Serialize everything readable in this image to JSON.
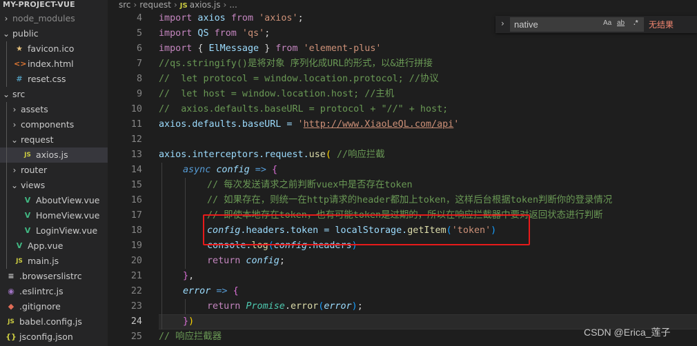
{
  "explorer": {
    "title": "MY-PROJECT-VUE",
    "items": [
      {
        "label": "node_modules",
        "type": "folder",
        "chev": "›",
        "icon": "",
        "color": "#8b8b8b"
      },
      {
        "label": "public",
        "type": "folder",
        "chev": "⌄",
        "icon": "",
        "color": "#cccccc"
      },
      {
        "label": "favicon.ico",
        "type": "file",
        "chev": "",
        "icon": "★",
        "color": "#cccccc"
      },
      {
        "label": "index.html",
        "type": "file",
        "chev": "",
        "icon": "<>",
        "color": "#cccccc"
      },
      {
        "label": "reset.css",
        "type": "file",
        "chev": "",
        "icon": "#",
        "color": "#cccccc"
      },
      {
        "label": "src",
        "type": "folder",
        "chev": "⌄",
        "icon": "",
        "color": "#cccccc"
      },
      {
        "label": "assets",
        "type": "folder",
        "chev": "›",
        "icon": "",
        "color": "#cccccc"
      },
      {
        "label": "components",
        "type": "folder",
        "chev": "›",
        "icon": "",
        "color": "#cccccc"
      },
      {
        "label": "request",
        "type": "folder",
        "chev": "⌄",
        "icon": "",
        "color": "#cccccc"
      },
      {
        "label": "axios.js",
        "type": "file",
        "chev": "",
        "icon": "JS",
        "color": "#cccccc"
      },
      {
        "label": "router",
        "type": "folder",
        "chev": "›",
        "icon": "",
        "color": "#cccccc"
      },
      {
        "label": "views",
        "type": "folder",
        "chev": "⌄",
        "icon": "",
        "color": "#cccccc"
      },
      {
        "label": "AboutView.vue",
        "type": "file",
        "chev": "",
        "icon": "V",
        "color": "#cccccc"
      },
      {
        "label": "HomeView.vue",
        "type": "file",
        "chev": "",
        "icon": "V",
        "color": "#cccccc"
      },
      {
        "label": "LoginView.vue",
        "type": "file",
        "chev": "",
        "icon": "V",
        "color": "#cccccc"
      },
      {
        "label": "App.vue",
        "type": "file",
        "chev": "",
        "icon": "V",
        "color": "#cccccc"
      },
      {
        "label": "main.js",
        "type": "file",
        "chev": "",
        "icon": "JS",
        "color": "#cccccc"
      },
      {
        "label": ".browserslistrc",
        "type": "file",
        "chev": "",
        "icon": "≡",
        "color": "#cccccc"
      },
      {
        "label": ".eslintrc.js",
        "type": "file",
        "chev": "",
        "icon": "◉",
        "color": "#cccccc"
      },
      {
        "label": ".gitignore",
        "type": "file",
        "chev": "",
        "icon": "◆",
        "color": "#cccccc"
      },
      {
        "label": "babel.config.js",
        "type": "file",
        "chev": "",
        "icon": "JS",
        "color": "#cccccc"
      },
      {
        "label": "jsconfig.json",
        "type": "file",
        "chev": "",
        "icon": "{}",
        "color": "#cccccc"
      }
    ]
  },
  "breadcrumb": {
    "seg1": "src",
    "seg2": "request",
    "file_icon": "JS",
    "seg3": "axios.js",
    "seg4": "..."
  },
  "editor": {
    "line_numbers": [
      "4",
      "5",
      "6",
      "7",
      "8",
      "9",
      "10",
      "11",
      "12",
      "13",
      "14",
      "15",
      "16",
      "17",
      "18",
      "19",
      "20",
      "21",
      "22",
      "23",
      "24",
      "25"
    ],
    "current_line": "24",
    "t": {
      "l4_import": "import",
      "l4_axios": " axios ",
      "l4_from": "from",
      "l4_str": " 'axios'",
      "l4_end": ";",
      "l5_import": "import",
      "l5_qs": " QS ",
      "l5_from": "from",
      "l5_str": " 'qs'",
      "l5_end": ";",
      "l6_import": "import",
      "l6_ob": " {",
      "l6_name": " ElMessage ",
      "l6_cb": "}",
      "l6_from": " from",
      "l6_str": " 'element-plus'",
      "l7": "//qs.stringify()是将对象 序列化成URL的形式，以&进行拼接",
      "l8": "//  let protocol = window.location.protocol; //协议",
      "l9": "//  let host = window.location.host; //主机",
      "l10": "//  axios.defaults.baseURL = protocol + \"//\" + host;",
      "l11_code": "axios.defaults.baseURL = ",
      "l11_q1": "'",
      "l11_url": "http://www.XiaoLeQL.com/api",
      "l11_q2": "'",
      "l13_obj": "axios.interceptors.request.",
      "l13_fn": "use",
      "l13_paren": "(",
      "l13_cm": " //响应拦截",
      "l14_async": "async",
      "l14_cfg": " config",
      "l14_arrow": " => ",
      "l14_brace": "{",
      "l15": "// 每次发送请求之前判断vuex中是否存在token",
      "l16": "// 如果存在，则统一在http请求的header都加上token，这样后台根据token判断你的登录情况",
      "l17": "// 即使本地存在token，也有可能token是过期的，所以在响应拦截器中要对返回状态进行判断",
      "l18_cfg": "config",
      "l18_mid": ".headers.token = localStorage.",
      "l18_fn": "getItem",
      "l18_p1": "(",
      "l18_str": "'token'",
      "l18_p2": ")",
      "l19_con": "console.",
      "l19_fn": "log",
      "l19_p1": "(",
      "l19_cfg": "config",
      "l19_mid": ".headers",
      "l19_p2": ")",
      "l20_ret": "return",
      "l20_cfg": " config",
      "l20_end": ";",
      "l21_brace": "}",
      "l21_comma": ",",
      "l22_err": "error",
      "l22_arrow": " => ",
      "l22_brace": "{",
      "l23_ret": "return",
      "l23_promise": " Promise",
      "l23_dot": ".",
      "l23_fn": "error",
      "l23_p1": "(",
      "l23_err": "error",
      "l23_p2": ")",
      "l23_end": ";",
      "l24_brace": "}",
      "l24_paren": ")",
      "l25": "// 响应拦截器"
    }
  },
  "find_widget": {
    "toggle_icon": "›",
    "query": "native",
    "match_case": "Aa",
    "whole_word": "ab",
    "regex": ".*",
    "result": "无结果"
  },
  "watermark": "CSDN @Erica_莲子",
  "colors": {
    "annotation_box": "#e81a1a",
    "selected_item_bg": "#37373d"
  }
}
